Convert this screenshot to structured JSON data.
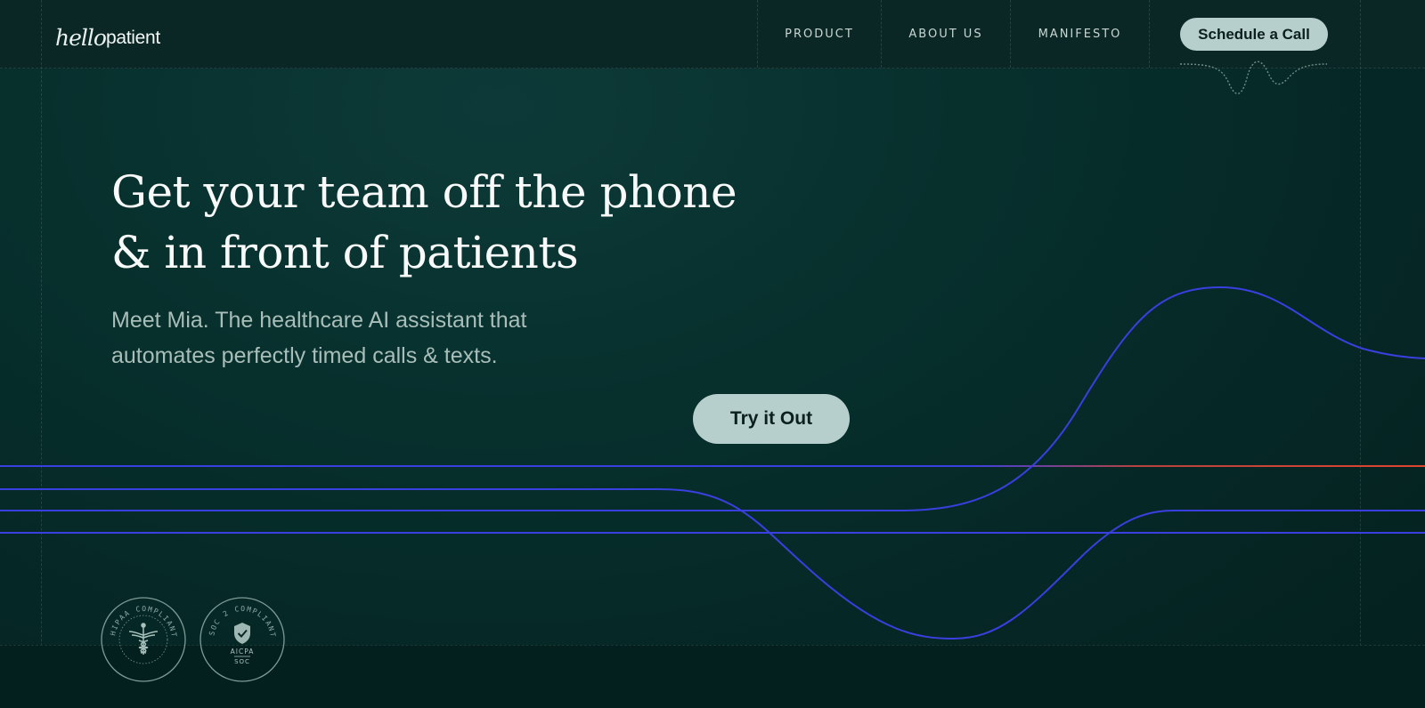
{
  "brand": {
    "logo_script": "hello",
    "logo_word": "patient"
  },
  "nav": {
    "items": [
      {
        "label": "PRODUCT"
      },
      {
        "label": "ABOUT US"
      },
      {
        "label": "MANIFESTO"
      }
    ],
    "cta_label": "Schedule a Call"
  },
  "hero": {
    "headline_line1": "Get your team off the phone",
    "headline_line2": "& in front of patients",
    "sub_line1": "Meet Mia. The healthcare AI assistant that",
    "sub_line2": "automates perfectly timed calls & texts.",
    "cta_label": "Try it Out"
  },
  "badges": {
    "hipaa_text": "HIPAA COMPLIANT",
    "soc_text": "SOC 2 COMPLIANT",
    "soc_org": "AICPA",
    "soc_sub": "SOC"
  },
  "colors": {
    "background": "#06211f",
    "button": "#b7cfcc",
    "wave_blue": "#3a3fe0",
    "wave_red": "#e0452f"
  }
}
